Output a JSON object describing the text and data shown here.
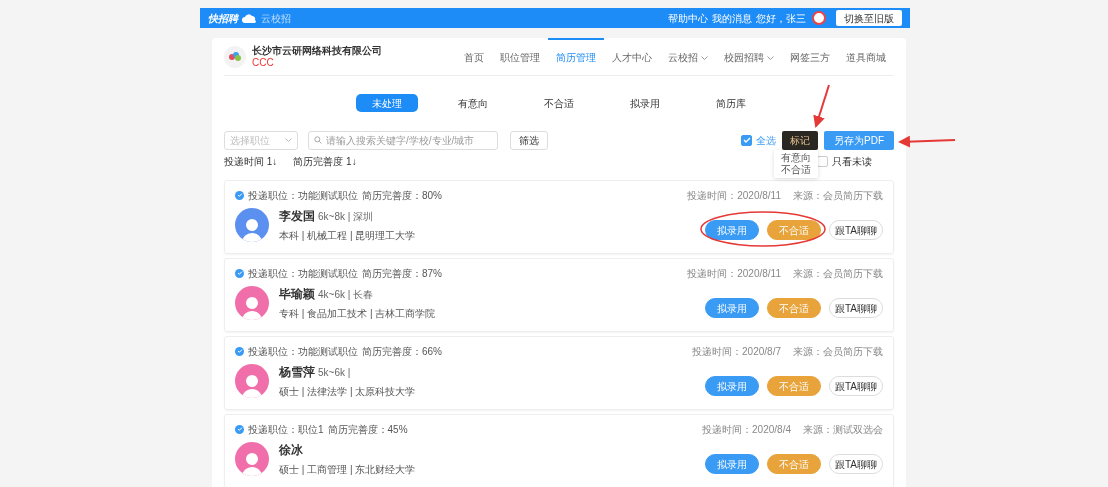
{
  "top_bar": {
    "logo_text": "快招聘",
    "sub_logo_text": "云校招",
    "links": [
      "帮助中心",
      "我的消息"
    ],
    "greeting": "您好，张三",
    "switch_button": "切换至旧版"
  },
  "company": {
    "name": "长沙市云研网络科技有限公司",
    "tag": "CCC"
  },
  "nav": [
    {
      "label": "首页",
      "selected": false,
      "dropdown": false
    },
    {
      "label": "职位管理",
      "selected": false,
      "dropdown": false
    },
    {
      "label": "简历管理",
      "selected": true,
      "dropdown": false
    },
    {
      "label": "人才中心",
      "selected": false,
      "dropdown": false
    },
    {
      "label": "云校招",
      "selected": false,
      "dropdown": true
    },
    {
      "label": "校园招聘",
      "selected": false,
      "dropdown": true
    },
    {
      "label": "网签三方",
      "selected": false,
      "dropdown": false
    },
    {
      "label": "道具商城",
      "selected": false,
      "dropdown": false
    }
  ],
  "status_tabs": [
    {
      "label": "未处理",
      "selected": true
    },
    {
      "label": "有意向",
      "selected": false
    },
    {
      "label": "不合适",
      "selected": false
    },
    {
      "label": "拟录用",
      "selected": false
    },
    {
      "label": "简历库",
      "selected": false
    }
  ],
  "filters": {
    "position_select": {
      "placeholder": "选择职位"
    },
    "search": {
      "placeholder": "请输入搜索关键字/学校/专业/城市"
    },
    "filter_button": "筛选",
    "select_all": {
      "label": "全选",
      "checked": true
    },
    "mark_button": "标记",
    "pdf_button": "另存为PDF",
    "unread_only": {
      "label": "只看未读",
      "checked": false
    }
  },
  "sort": [
    "投递时间 1↓",
    "简历完善度 1↓"
  ],
  "mark_menu": [
    "有意向",
    "不合适"
  ],
  "candidates": [
    {
      "position": "投递职位：功能测试职位",
      "completeness": "简历完善度：80%",
      "time": "投递时间：2020/8/11",
      "source": "来源：会员简历下载",
      "name": "李发国",
      "info": "6k~8k | 深圳",
      "education": "本科 | 机械工程 | 昆明理工大学",
      "color": "#5b8ff0",
      "actions": [
        "拟录用",
        "不合适",
        "跟TA聊聊"
      ]
    },
    {
      "position": "投递职位：功能测试职位",
      "completeness": "简历完善度：87%",
      "time": "投递时间：2020/8/11",
      "source": "来源：会员简历下载",
      "name": "毕瑜颖",
      "info": "4k~6k | 长春",
      "education": "专科 | 食品加工技术 | 吉林工商学院",
      "color": "#f06ea9",
      "actions": [
        "拟录用",
        "不合适",
        "跟TA聊聊"
      ]
    },
    {
      "position": "投递职位：功能测试职位",
      "completeness": "简历完善度：66%",
      "time": "投递时间：2020/8/7",
      "source": "来源：会员简历下载",
      "name": "杨雪萍",
      "info": "5k~6k |",
      "education": "硕士 | 法律法学 | 太原科技大学",
      "color": "#f06ea9",
      "actions": [
        "拟录用",
        "不合适",
        "跟TA聊聊"
      ]
    },
    {
      "position": "投递职位：职位1",
      "completeness": "简历完善度：45%",
      "time": "投递时间：2020/8/4",
      "source": "来源：测试双选会",
      "name": "徐冰",
      "education": "硕士 | 工商管理 | 东北财经大学",
      "color": "#f06ea9",
      "actions": [
        "拟录用",
        "不合适",
        "跟TA聊聊"
      ]
    }
  ]
}
